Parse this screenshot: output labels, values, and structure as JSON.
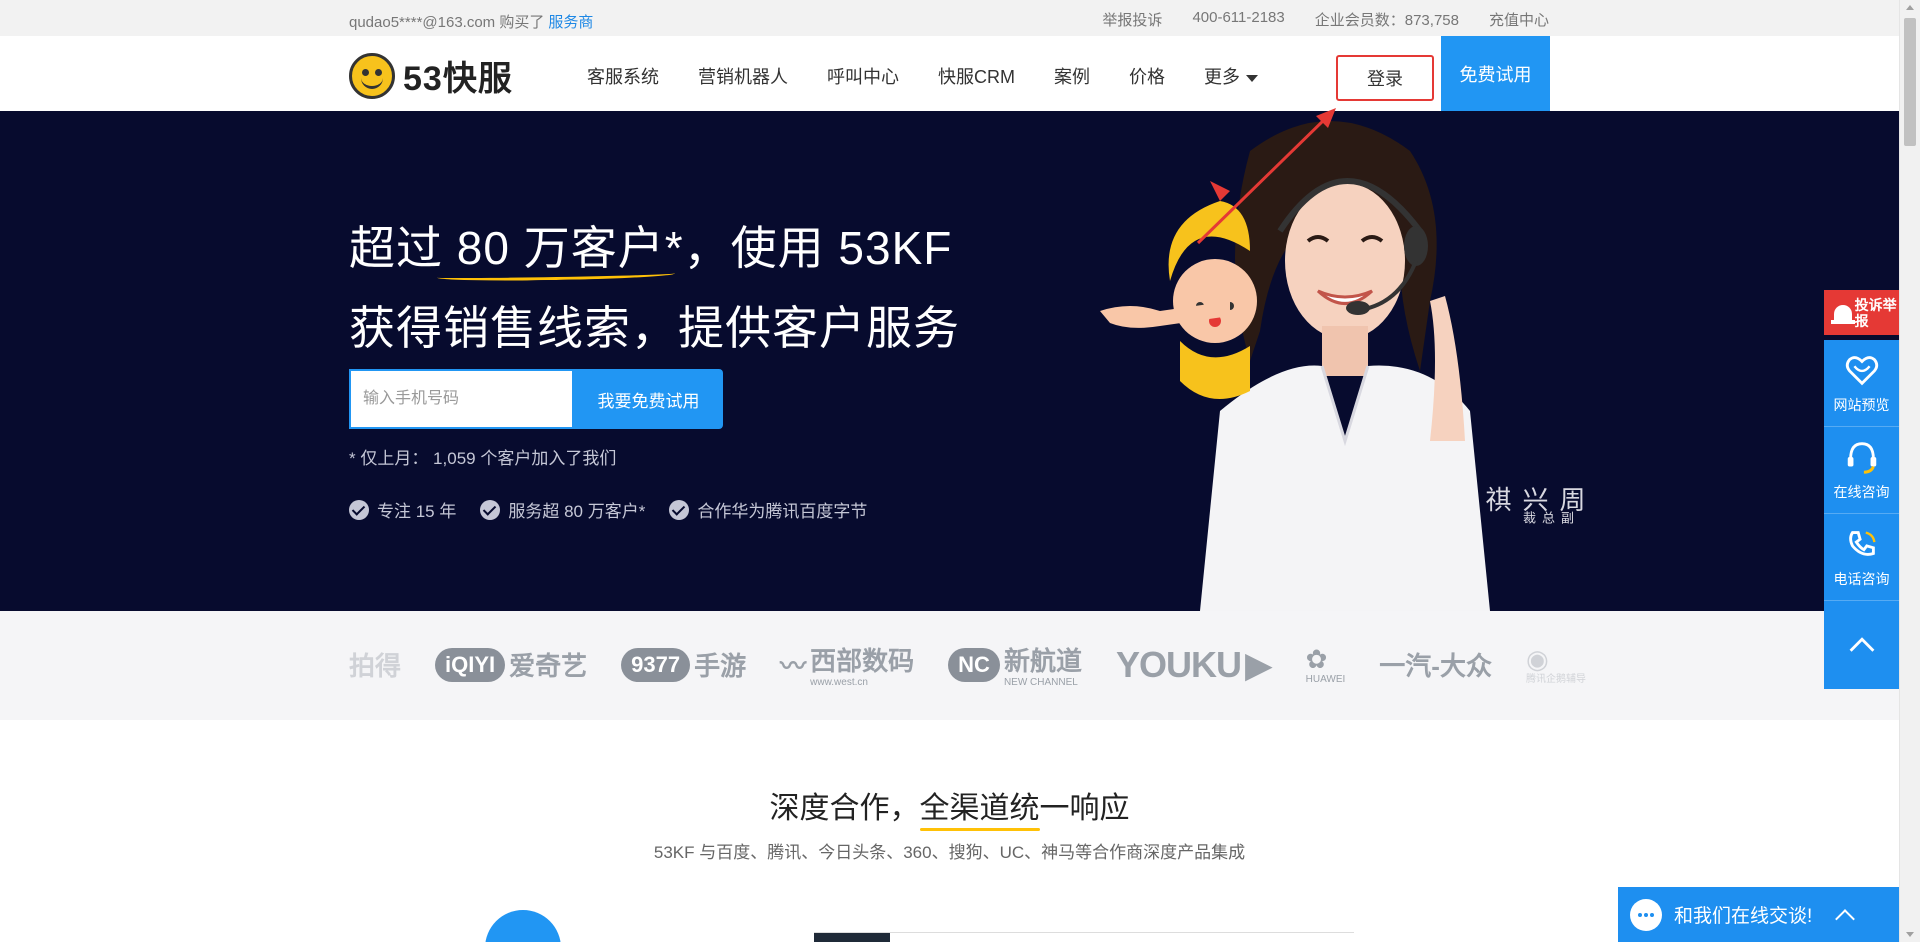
{
  "topbar": {
    "purchase_text": "qudao5****@163.com 购买了",
    "purchase_link": "服务商",
    "links": [
      "举报投诉",
      "400-611-2183",
      "企业会员数：873,758",
      "充值中心"
    ]
  },
  "header": {
    "logo_text": "53快服",
    "nav": [
      "客服系统",
      "营销机器人",
      "呼叫中心",
      "快服CRM",
      "案例",
      "价格",
      "更多"
    ],
    "login": "登录",
    "free_trial": "免费试用"
  },
  "hero": {
    "title_prefix": "超过 ",
    "title_highlight": "80 万客户",
    "title_suffix": "*，使用 53KF",
    "title_line2": "获得销售线索，提供客户服务",
    "phone_placeholder": "输入手机号码",
    "submit": "我要免费试用",
    "note": "* 仅上月：  1,059 个客户加入了我们",
    "features": [
      "专注 15 年",
      "服务超 80 万客户*",
      "合作华为腾讯百度字节"
    ],
    "signature_name": "周兴祺",
    "signature_title": "副总裁"
  },
  "clients": {
    "logos": [
      "拍得",
      "爱奇艺",
      "9377",
      "手游",
      "西部数码",
      "www.west.cn",
      "新航道",
      "NEW CHANNEL",
      "YOUKU",
      "HUAWEI",
      "一汽-大众",
      "腾讯企鹅辅导"
    ]
  },
  "section": {
    "title_prefix": "深度合作，",
    "title_highlight": "全渠道统",
    "title_suffix": "一响应",
    "subtitle": "53KF 与百度、腾讯、今日头条、360、搜狗、UC、神马等合作商深度产品集成"
  },
  "sidebar": {
    "report": "投诉举报",
    "items": [
      "网站预览",
      "在线咨询",
      "电话咨询"
    ]
  },
  "chat": {
    "label": "和我们在线交谈!"
  },
  "colors": {
    "primary": "#2196f3",
    "hero_bg": "#070b2e",
    "highlight": "#ffc107",
    "report_red": "#e53935"
  }
}
